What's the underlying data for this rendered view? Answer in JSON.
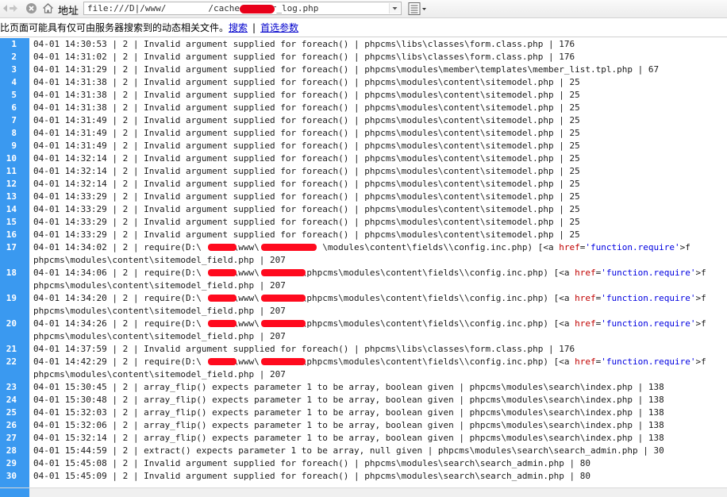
{
  "toolbar": {
    "address_label": "地址",
    "address_value": "file:///D|/www/        /caches/error_log.php",
    "icons": [
      "back-icon",
      "forward-icon",
      "stop-icon",
      "home-icon",
      "menu-icon"
    ]
  },
  "infobar": {
    "message": "比页面可能具有仅可由服务器搜索到的动态相关文件。",
    "search_link": "搜索",
    "separator": "|",
    "prefs_link": "首选参数"
  },
  "colors": {
    "gutter": "#3a99f0",
    "redaction": "#ff0a1e",
    "attr": "#c00000",
    "value": "#0000e0"
  },
  "log": {
    "lines": [
      {
        "n": "1",
        "text": "04-01 14:30:53 | 2 | Invalid argument supplied for foreach() | phpcms\\libs\\classes\\form.class.php | 176"
      },
      {
        "n": "2",
        "text": "04-01 14:31:02 | 2 | Invalid argument supplied for foreach() | phpcms\\libs\\classes\\form.class.php | 176"
      },
      {
        "n": "3",
        "text": "04-01 14:31:29 | 2 | Invalid argument supplied for foreach() | phpcms\\modules\\member\\templates\\member_list.tpl.php | 67"
      },
      {
        "n": "4",
        "text": "04-01 14:31:38 | 2 | Invalid argument supplied for foreach() | phpcms\\modules\\content\\sitemodel.php | 25"
      },
      {
        "n": "5",
        "text": "04-01 14:31:38 | 2 | Invalid argument supplied for foreach() | phpcms\\modules\\content\\sitemodel.php | 25"
      },
      {
        "n": "6",
        "text": "04-01 14:31:38 | 2 | Invalid argument supplied for foreach() | phpcms\\modules\\content\\sitemodel.php | 25"
      },
      {
        "n": "7",
        "text": "04-01 14:31:49 | 2 | Invalid argument supplied for foreach() | phpcms\\modules\\content\\sitemodel.php | 25"
      },
      {
        "n": "8",
        "text": "04-01 14:31:49 | 2 | Invalid argument supplied for foreach() | phpcms\\modules\\content\\sitemodel.php | 25"
      },
      {
        "n": "9",
        "text": "04-01 14:31:49 | 2 | Invalid argument supplied for foreach() | phpcms\\modules\\content\\sitemodel.php | 25"
      },
      {
        "n": "10",
        "text": "04-01 14:32:14 | 2 | Invalid argument supplied for foreach() | phpcms\\modules\\content\\sitemodel.php | 25"
      },
      {
        "n": "11",
        "text": "04-01 14:32:14 | 2 | Invalid argument supplied for foreach() | phpcms\\modules\\content\\sitemodel.php | 25"
      },
      {
        "n": "12",
        "text": "04-01 14:32:14 | 2 | Invalid argument supplied for foreach() | phpcms\\modules\\content\\sitemodel.php | 25"
      },
      {
        "n": "13",
        "text": "04-01 14:33:29 | 2 | Invalid argument supplied for foreach() | phpcms\\modules\\content\\sitemodel.php | 25"
      },
      {
        "n": "14",
        "text": "04-01 14:33:29 | 2 | Invalid argument supplied for foreach() | phpcms\\modules\\content\\sitemodel.php | 25"
      },
      {
        "n": "15",
        "text": "04-01 14:33:29 | 2 | Invalid argument supplied for foreach() | phpcms\\modules\\content\\sitemodel.php | 25"
      },
      {
        "n": "16",
        "text": "04-01 14:33:29 | 2 | Invalid argument supplied for foreach() | phpcms\\modules\\content\\sitemodel.php | 25"
      },
      {
        "n": "17",
        "pre": "04-01 14:34:02 | 2 | require(D:\\      \\www\\            \\modules\\content\\fields\\\\config.inc.php) [<a ",
        "attr": "href",
        "eq": "=",
        "val": "'function.require'",
        "post": ">f",
        "cont": "phpcms\\modules\\content\\sitemodel_field.php | 207"
      },
      {
        "n": "18",
        "pre": "04-01 14:34:06 | 2 | require(D:\\      \\www\\        \\phpcms\\modules\\content\\fields\\\\config.inc.php) [<a ",
        "attr": "href",
        "eq": "=",
        "val": "'function.require'",
        "post": ">f",
        "cont": "phpcms\\modules\\content\\sitemodel_field.php | 207"
      },
      {
        "n": "19",
        "pre": "04-01 14:34:20 | 2 | require(D:\\      \\www\\        \\phpcms\\modules\\content\\fields\\\\config.inc.php) [<a ",
        "attr": "href",
        "eq": "=",
        "val": "'function.require'",
        "post": ">f",
        "cont": "phpcms\\modules\\content\\sitemodel_field.php | 207"
      },
      {
        "n": "20",
        "pre": "04-01 14:34:26 | 2 | require(D:\\      \\www\\        \\phpcms\\modules\\content\\fields\\\\config.inc.php) [<a ",
        "attr": "href",
        "eq": "=",
        "val": "'function.require'",
        "post": ">f",
        "cont": "phpcms\\modules\\content\\sitemodel_field.php | 207"
      },
      {
        "n": "21",
        "text": "04-01 14:37:59 | 2 | Invalid argument supplied for foreach() | phpcms\\libs\\classes\\form.class.php | 176"
      },
      {
        "n": "22",
        "pre": "04-01 14:42:29 | 2 | require(D:\\      \\www\\        \\phpcms\\modules\\content\\fields\\\\config.inc.php) [<a ",
        "attr": "href",
        "eq": "=",
        "val": "'function.require'",
        "post": ">f",
        "cont": "phpcms\\modules\\content\\sitemodel_field.php | 207"
      },
      {
        "n": "23",
        "text": "04-01 15:30:45 | 2 | array_flip() expects parameter 1 to be array, boolean given | phpcms\\modules\\search\\index.php | 138"
      },
      {
        "n": "24",
        "text": "04-01 15:30:48 | 2 | array_flip() expects parameter 1 to be array, boolean given | phpcms\\modules\\search\\index.php | 138"
      },
      {
        "n": "25",
        "text": "04-01 15:32:03 | 2 | array_flip() expects parameter 1 to be array, boolean given | phpcms\\modules\\search\\index.php | 138"
      },
      {
        "n": "26",
        "text": "04-01 15:32:06 | 2 | array_flip() expects parameter 1 to be array, boolean given | phpcms\\modules\\search\\index.php | 138"
      },
      {
        "n": "27",
        "text": "04-01 15:32:14 | 2 | array_flip() expects parameter 1 to be array, boolean given | phpcms\\modules\\search\\index.php | 138"
      },
      {
        "n": "28",
        "text": "04-01 15:44:59 | 2 | extract() expects parameter 1 to be array, null given | phpcms\\modules\\search\\search_admin.php | 30"
      },
      {
        "n": "29",
        "text": "04-01 15:45:08 | 2 | Invalid argument supplied for foreach() | phpcms\\modules\\search\\search_admin.php | 80"
      },
      {
        "n": "30",
        "text": "04-01 15:45:09 | 2 | Invalid argument supplied for foreach() | phpcms\\modules\\search\\search_admin.php | 80"
      }
    ]
  }
}
